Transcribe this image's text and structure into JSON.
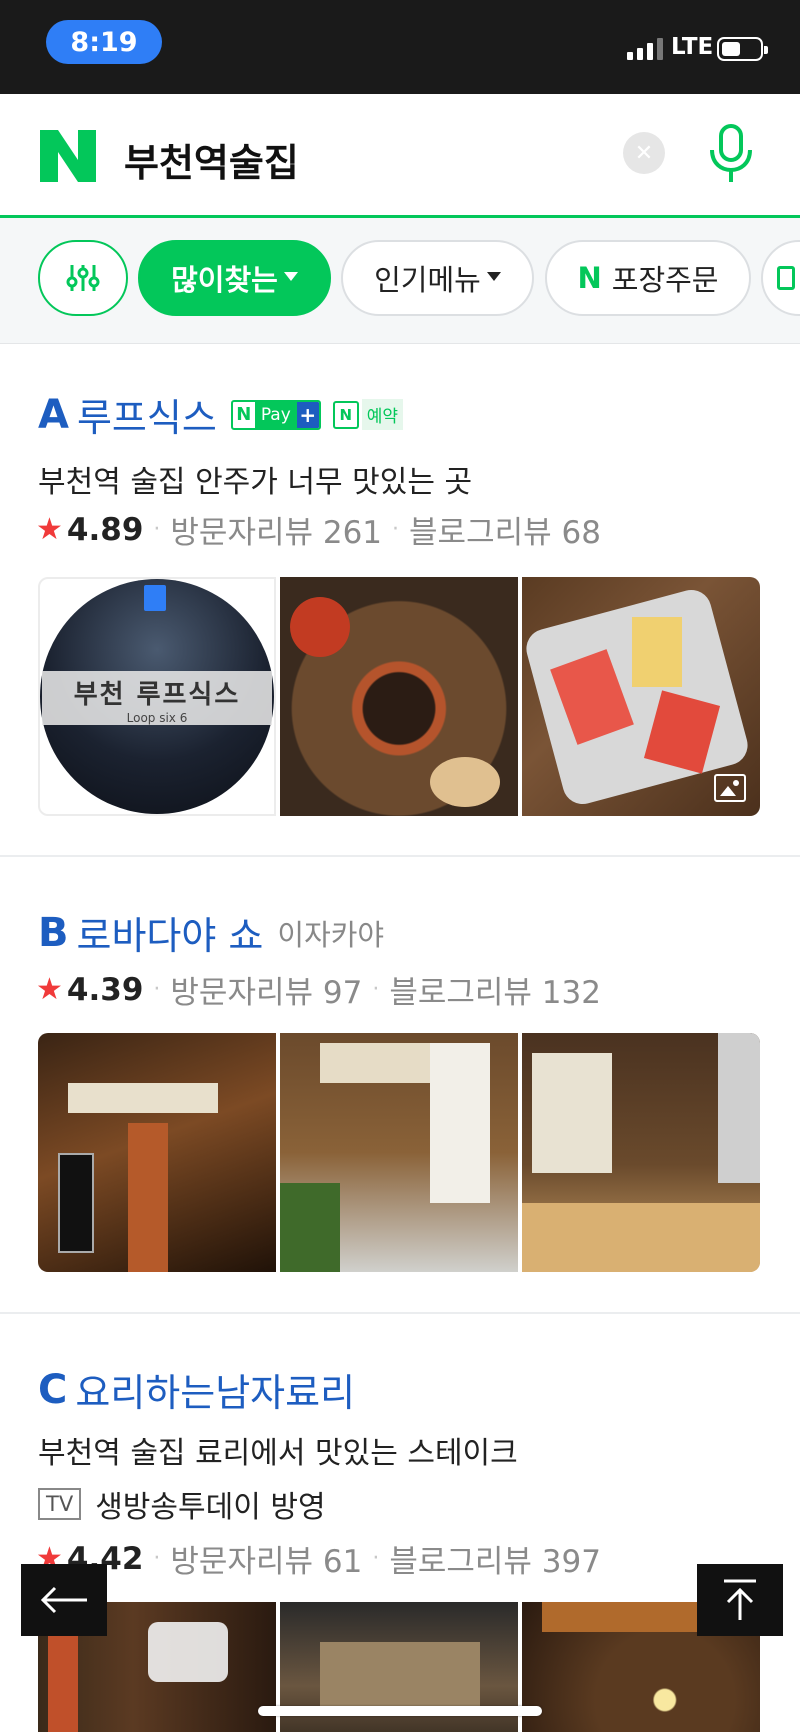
{
  "status_bar": {
    "time": "8:19",
    "network": "LTE"
  },
  "search": {
    "query": "부천역술집"
  },
  "filters": {
    "chips": [
      "많이찾는",
      "인기메뉴",
      "포장주문"
    ],
    "takeout_prefix": "N"
  },
  "listings": [
    {
      "letter": "A",
      "name": "루프식스",
      "badges": {
        "pay": "Pay",
        "booking": "예약"
      },
      "description": "부천역 술집 안주가 너무 맛있는 곳",
      "rating": "4.89",
      "visitor_reviews": "방문자리뷰 261",
      "blog_reviews": "블로그리뷰 68",
      "logo_text": "부천 루프식스",
      "logo_subtext": "Loop six 6"
    },
    {
      "letter": "B",
      "name": "로바다야 쇼",
      "category": "이자카야",
      "rating": "4.39",
      "visitor_reviews": "방문자리뷰 97",
      "blog_reviews": "블로그리뷰 132"
    },
    {
      "letter": "C",
      "name": "요리하는남자료리",
      "description": "부천역 술집 료리에서 맛있는 스테이크",
      "tv_badge": "TV",
      "tv_text": "생방송투데이 방영",
      "rating": "4.42",
      "visitor_reviews": "방문자리뷰 61",
      "blog_reviews": "블로그리뷰 397"
    }
  ],
  "colors": {
    "naver_green": "#03c75a",
    "link_blue": "#1d5dc0",
    "star_red": "#f03a3a"
  }
}
